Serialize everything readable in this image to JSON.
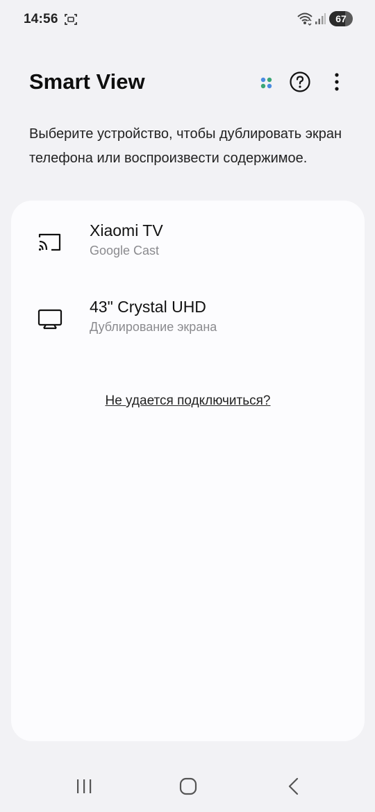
{
  "status_bar": {
    "time": "14:56",
    "battery": "67",
    "battery_level": 0.67,
    "icons": [
      "screenshot-icon",
      "wifi-icon",
      "signal-icon",
      "battery-icon"
    ]
  },
  "header": {
    "title": "Smart View",
    "actions": [
      "dots-icon",
      "help-icon",
      "more-icon"
    ],
    "dot_colors": [
      "#4a8be0",
      "#3aa675",
      "#3aa675",
      "#4a8be0"
    ]
  },
  "description": "Выберите устройство, чтобы дублировать экран телефона или воспроизвести содержимое.",
  "devices": [
    {
      "name": "Xiaomi TV",
      "subtitle": "Google Cast",
      "icon": "cast-icon"
    },
    {
      "name": "43\" Crystal UHD",
      "subtitle": "Дублирование экрана",
      "icon": "tv-icon"
    }
  ],
  "help_link": "Не удается подключиться?",
  "nav_bar": {
    "icons": [
      "recent-apps-icon",
      "home-icon",
      "back-icon"
    ]
  }
}
